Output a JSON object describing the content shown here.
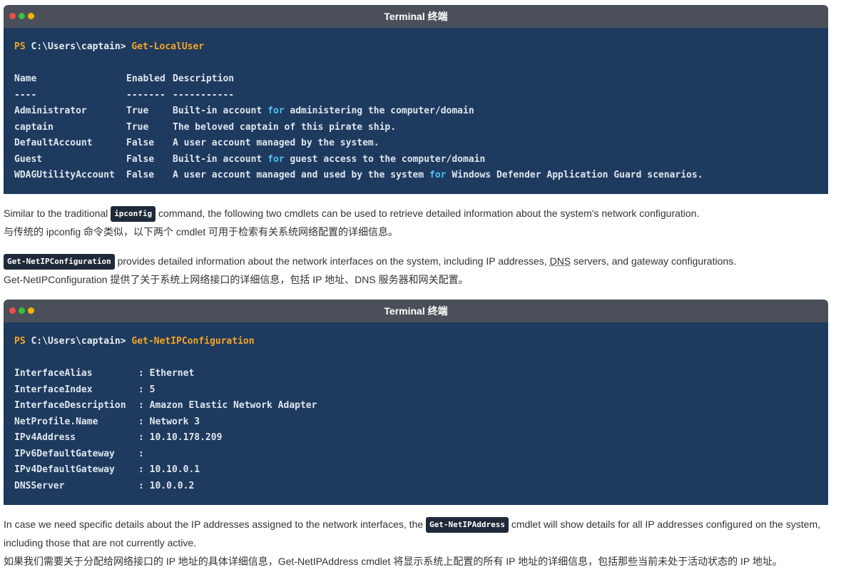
{
  "terminal1": {
    "title": "Terminal  终端",
    "prompt": "PS",
    "path": " C:\\Users\\captain> ",
    "command": "Get-LocalUser",
    "header": {
      "name": "Name",
      "enabled": "Enabled",
      "description": "Description"
    },
    "divider": {
      "name": "----",
      "enabled": "-------",
      "description": "-----------"
    },
    "rows": [
      {
        "name": "Administrator",
        "enabled": "True",
        "pre": "Built-in account ",
        "kw": "for",
        "post": " administering the computer/domain"
      },
      {
        "name": "captain",
        "enabled": "True",
        "pre": "The beloved captain of this pirate ship.",
        "kw": "",
        "post": ""
      },
      {
        "name": "DefaultAccount",
        "enabled": "False",
        "pre": "A user account managed by the system.",
        "kw": "",
        "post": ""
      },
      {
        "name": "Guest",
        "enabled": "False",
        "pre": "Built-in account ",
        "kw": "for",
        "post": " guest access to the computer/domain"
      },
      {
        "name": "WDAGUtilityAccount",
        "enabled": "False",
        "pre": "A user account managed and used by the system ",
        "kw": "for",
        "post": " Windows Defender Application Guard scenarios."
      }
    ]
  },
  "para1": {
    "before": "Similar to the traditional ",
    "code": "ipconfig",
    "after": " command, the following two cmdlets can be used to retrieve detailed information about the system's network configuration.",
    "zh": "与传统的 ipconfig 命令类似，以下两个 cmdlet 可用于检索有关系统网络配置的详细信息。"
  },
  "para2": {
    "code": "Get-NetIPConfiguration",
    "before": " provides detailed information about the network interfaces on the system, including IP addresses, ",
    "dns": "DNS",
    "after": " servers, and gateway configurations.",
    "zh": "Get-NetIPConfiguration 提供了关于系统上网络接口的详细信息，包括 IP 地址、DNS 服务器和网关配置。"
  },
  "terminal2": {
    "title": "Terminal  终端",
    "prompt": "PS",
    "path": " C:\\Users\\captain> ",
    "command": "Get-NetIPConfiguration",
    "rows": [
      {
        "key": "InterfaceAlias",
        "value": "Ethernet"
      },
      {
        "key": "InterfaceIndex",
        "value": "5"
      },
      {
        "key": "InterfaceDescription",
        "value": "Amazon Elastic Network Adapter"
      },
      {
        "key": "NetProfile.Name",
        "value": "Network 3"
      },
      {
        "key": "IPv4Address",
        "value": "10.10.178.209"
      },
      {
        "key": "IPv6DefaultGateway",
        "value": ""
      },
      {
        "key": "IPv4DefaultGateway",
        "value": "10.10.0.1"
      },
      {
        "key": "DNSServer",
        "value": "10.0.0.2"
      }
    ]
  },
  "para3": {
    "before": "In case we need specific details about the IP addresses assigned to the network interfaces, the ",
    "code": "Get-NetIPAddress",
    "after": " cmdlet will show details for all IP addresses configured on the system, including those that are not currently active.",
    "zh": "如果我们需要关于分配给网络接口的 IP 地址的具体详细信息，Get-NetIPAddress cmdlet 将显示系统上配置的所有 IP 地址的详细信息，包括那些当前未处于活动状态的 IP 地址。"
  }
}
